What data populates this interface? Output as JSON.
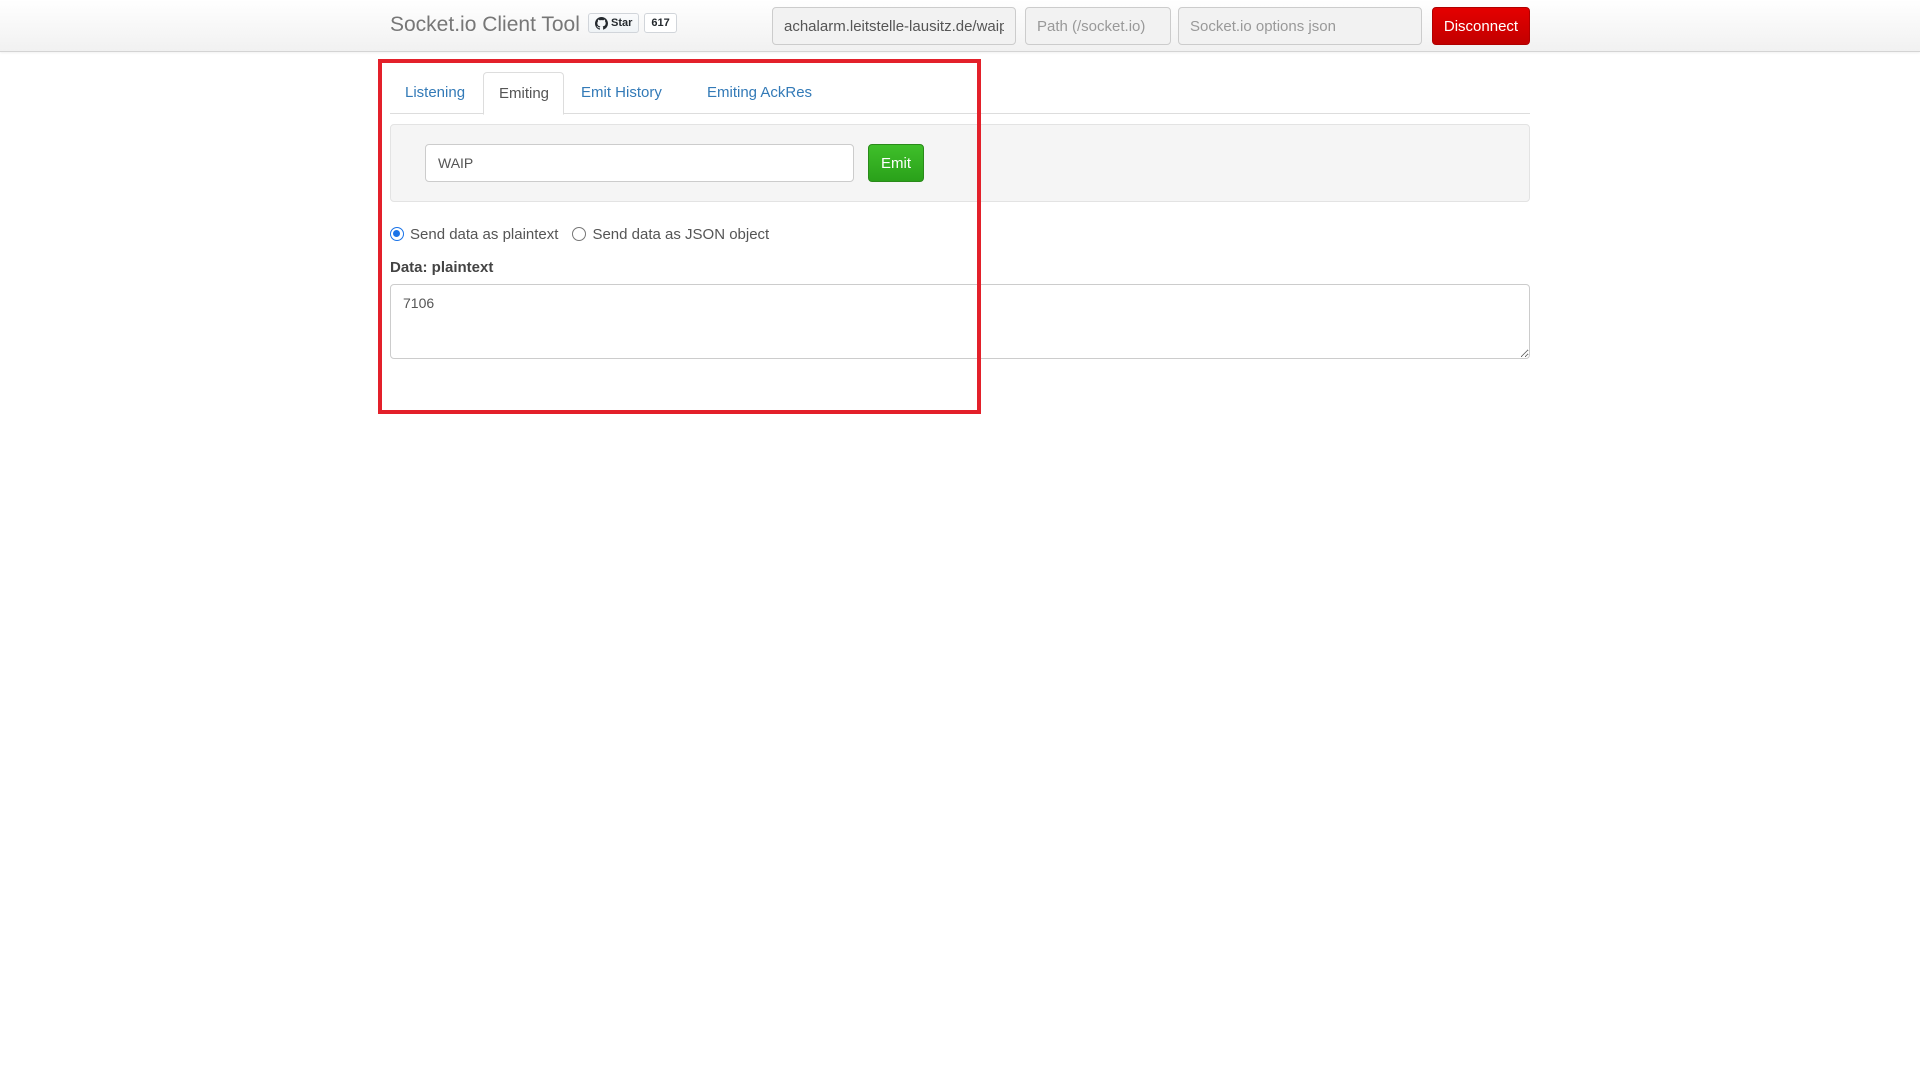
{
  "navbar": {
    "brand": "Socket.io Client Tool",
    "github_star_label": "Star",
    "github_star_count": "617",
    "url_value": "achalarm.leitstelle-lausitz.de/waip",
    "path_placeholder": "Path (/socket.io)",
    "options_placeholder": "Socket.io options json",
    "disconnect_label": "Disconnect"
  },
  "tabs": [
    {
      "label": "Listening",
      "active": false
    },
    {
      "label": "Emiting",
      "active": true
    },
    {
      "label": "Emit History",
      "active": false
    },
    {
      "label": "Emiting AckRes",
      "active": false
    }
  ],
  "emit": {
    "event_value": "WAIP",
    "emit_label": "Emit"
  },
  "data_mode": {
    "options": [
      {
        "label": "Send data as plaintext",
        "checked": true
      },
      {
        "label": "Send data as JSON object",
        "checked": false
      }
    ]
  },
  "data": {
    "label": "Data: plaintext",
    "value": "7106"
  },
  "colors": {
    "disconnect": "#d40000",
    "emit": "#32b022",
    "link": "#337ab7",
    "highlight": "#e3202a"
  }
}
